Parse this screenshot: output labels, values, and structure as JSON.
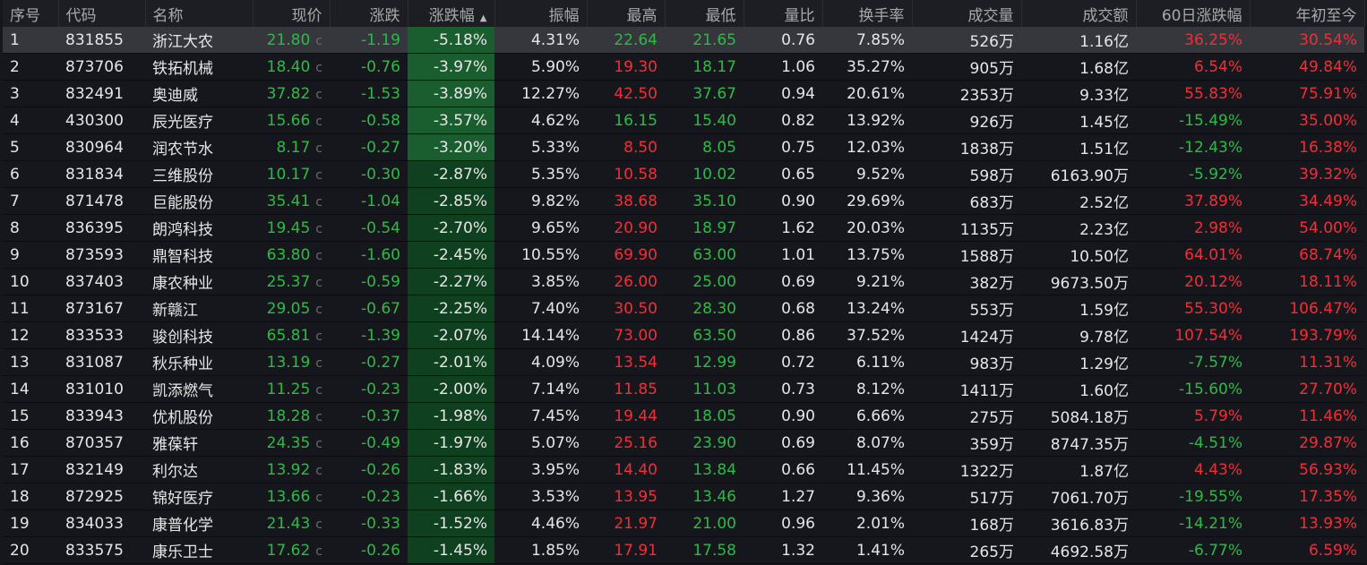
{
  "colors": {
    "up": "#ee2f3a",
    "down": "#2fb84a",
    "highlight": "#36373c",
    "change_bg": "#0f4020"
  },
  "headers": [
    "序号",
    "代码",
    "名称",
    "现价",
    "涨跌",
    "涨跌幅",
    "振幅",
    "最高",
    "最低",
    "量比",
    "换手率",
    "成交量",
    "成交额",
    "60日涨跌幅",
    "年初至今"
  ],
  "sort_icon": "sort-ascending-icon",
  "price_suffix": "c",
  "rows": [
    [
      "1",
      "831855",
      "浙江大农",
      "21.80",
      "-1.19",
      "-5.18%",
      "4.31%",
      "22.64",
      "21.65",
      "0.76",
      "7.85%",
      "526万",
      "1.16亿",
      "36.25%",
      "30.54%"
    ],
    [
      "2",
      "873706",
      "铁拓机械",
      "18.40",
      "-0.76",
      "-3.97%",
      "5.90%",
      "19.30",
      "18.17",
      "1.06",
      "35.27%",
      "905万",
      "1.68亿",
      "6.54%",
      "49.84%"
    ],
    [
      "3",
      "832491",
      "奥迪威",
      "37.82",
      "-1.53",
      "-3.89%",
      "12.27%",
      "42.50",
      "37.67",
      "0.94",
      "20.61%",
      "2353万",
      "9.33亿",
      "55.83%",
      "75.91%"
    ],
    [
      "4",
      "430300",
      "辰光医疗",
      "15.66",
      "-0.58",
      "-3.57%",
      "4.62%",
      "16.15",
      "15.40",
      "0.82",
      "13.92%",
      "926万",
      "1.45亿",
      "-15.49%",
      "35.00%"
    ],
    [
      "5",
      "830964",
      "润农节水",
      "8.17",
      "-0.27",
      "-3.20%",
      "5.33%",
      "8.50",
      "8.05",
      "0.75",
      "12.03%",
      "1838万",
      "1.51亿",
      "-12.43%",
      "16.38%"
    ],
    [
      "6",
      "831834",
      "三维股份",
      "10.17",
      "-0.30",
      "-2.87%",
      "5.35%",
      "10.58",
      "10.02",
      "0.65",
      "9.52%",
      "598万",
      "6163.90万",
      "-5.92%",
      "39.32%"
    ],
    [
      "7",
      "871478",
      "巨能股份",
      "35.41",
      "-1.04",
      "-2.85%",
      "9.82%",
      "38.68",
      "35.10",
      "0.90",
      "29.69%",
      "683万",
      "2.52亿",
      "37.89%",
      "34.49%"
    ],
    [
      "8",
      "836395",
      "朗鸿科技",
      "19.45",
      "-0.54",
      "-2.70%",
      "9.65%",
      "20.90",
      "18.97",
      "1.62",
      "20.03%",
      "1135万",
      "2.23亿",
      "2.98%",
      "54.00%"
    ],
    [
      "9",
      "873593",
      "鼎智科技",
      "63.80",
      "-1.60",
      "-2.45%",
      "10.55%",
      "69.90",
      "63.00",
      "1.01",
      "13.75%",
      "1588万",
      "10.50亿",
      "64.01%",
      "68.74%"
    ],
    [
      "10",
      "837403",
      "康农种业",
      "25.37",
      "-0.59",
      "-2.27%",
      "3.85%",
      "26.00",
      "25.00",
      "0.69",
      "9.21%",
      "382万",
      "9673.50万",
      "20.12%",
      "18.11%"
    ],
    [
      "11",
      "873167",
      "新赣江",
      "29.05",
      "-0.67",
      "-2.25%",
      "7.40%",
      "30.50",
      "28.30",
      "0.68",
      "13.24%",
      "553万",
      "1.59亿",
      "55.30%",
      "106.47%"
    ],
    [
      "12",
      "833533",
      "骏创科技",
      "65.81",
      "-1.39",
      "-2.07%",
      "14.14%",
      "73.00",
      "63.50",
      "0.86",
      "37.52%",
      "1424万",
      "9.78亿",
      "107.54%",
      "193.79%"
    ],
    [
      "13",
      "831087",
      "秋乐种业",
      "13.19",
      "-0.27",
      "-2.01%",
      "4.09%",
      "13.54",
      "12.99",
      "0.72",
      "6.11%",
      "983万",
      "1.29亿",
      "-7.57%",
      "11.31%"
    ],
    [
      "14",
      "831010",
      "凯添燃气",
      "11.25",
      "-0.23",
      "-2.00%",
      "7.14%",
      "11.85",
      "11.03",
      "0.73",
      "8.12%",
      "1411万",
      "1.60亿",
      "-15.60%",
      "27.70%"
    ],
    [
      "15",
      "833943",
      "优机股份",
      "18.28",
      "-0.37",
      "-1.98%",
      "7.45%",
      "19.44",
      "18.05",
      "0.90",
      "6.66%",
      "275万",
      "5084.18万",
      "5.79%",
      "11.46%"
    ],
    [
      "16",
      "870357",
      "雅葆轩",
      "24.35",
      "-0.49",
      "-1.97%",
      "5.07%",
      "25.16",
      "23.90",
      "0.69",
      "8.07%",
      "359万",
      "8747.35万",
      "-4.51%",
      "29.87%"
    ],
    [
      "17",
      "832149",
      "利尔达",
      "13.92",
      "-0.26",
      "-1.83%",
      "3.95%",
      "14.40",
      "13.84",
      "0.66",
      "11.45%",
      "1322万",
      "1.87亿",
      "4.43%",
      "56.93%"
    ],
    [
      "18",
      "872925",
      "锦好医疗",
      "13.66",
      "-0.23",
      "-1.66%",
      "3.53%",
      "13.95",
      "13.46",
      "1.27",
      "9.36%",
      "517万",
      "7061.70万",
      "-19.55%",
      "17.35%"
    ],
    [
      "19",
      "834033",
      "康普化学",
      "21.43",
      "-0.33",
      "-1.52%",
      "4.46%",
      "21.97",
      "21.00",
      "0.96",
      "2.01%",
      "168万",
      "3616.83万",
      "-14.21%",
      "13.93%"
    ],
    [
      "20",
      "833575",
      "康乐卫士",
      "17.62",
      "-0.26",
      "-1.45%",
      "1.85%",
      "17.91",
      "17.58",
      "1.32",
      "1.41%",
      "265万",
      "4692.58万",
      "-6.77%",
      "6.59%"
    ]
  ]
}
